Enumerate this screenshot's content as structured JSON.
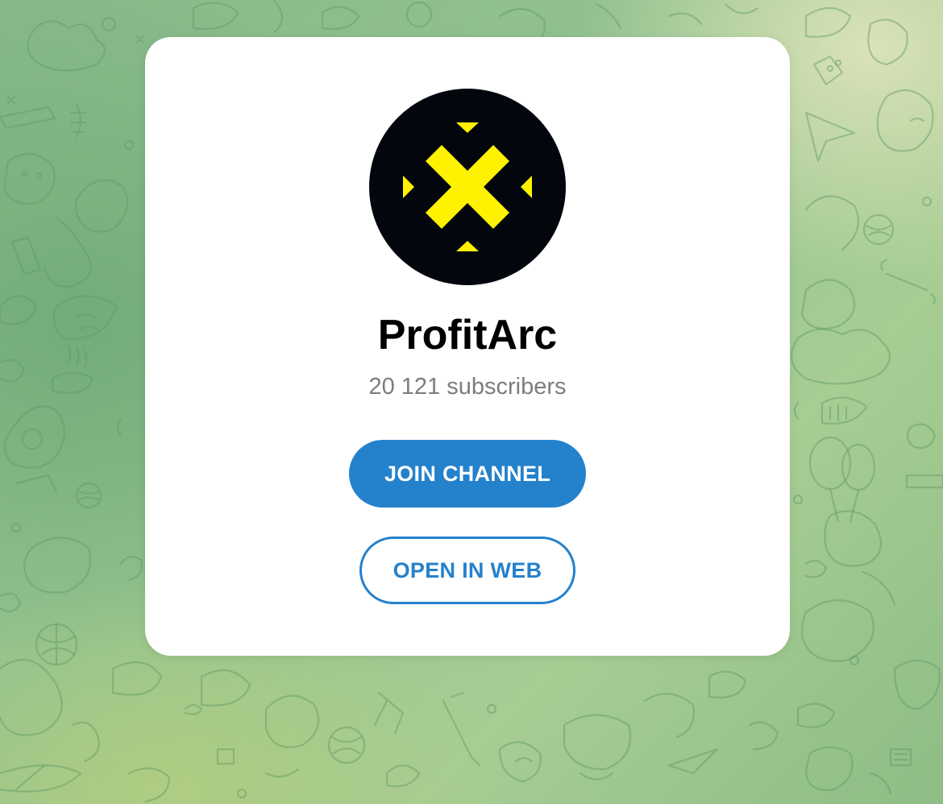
{
  "channel": {
    "name": "ProfitArc",
    "subscribers": "20 121 subscribers",
    "avatar_icon": "yellow-x-arrows-logo",
    "avatar_background": "#03070d",
    "avatar_accent": "#fff200"
  },
  "actions": {
    "join_label": "JOIN CHANNEL",
    "open_web_label": "OPEN IN WEB"
  },
  "theme": {
    "accent": "#2481cc",
    "background_pattern": "telegram-doodle-pattern"
  }
}
